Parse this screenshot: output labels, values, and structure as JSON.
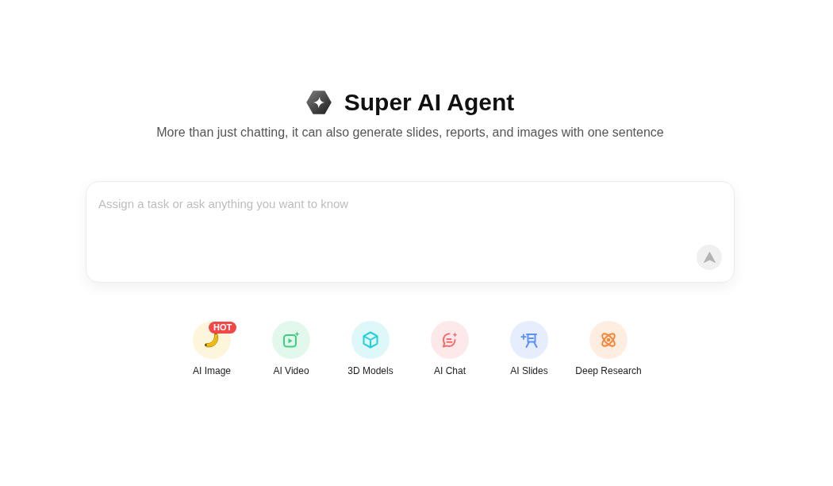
{
  "header": {
    "title": "Super AI Agent",
    "subtitle": "More than just chatting, it can also generate slides, reports, and images with one sentence"
  },
  "prompt": {
    "placeholder": "Assign a task or ask anything you want to know",
    "send_button": {
      "disabled": true
    }
  },
  "tools": [
    {
      "label": "AI Image",
      "badge": "HOT",
      "color": "#f5c518"
    },
    {
      "label": "AI Video",
      "color": "#3ccf7d"
    },
    {
      "label": "3D Models",
      "color": "#22cfdb"
    },
    {
      "label": "AI Chat",
      "color": "#f26b6b"
    },
    {
      "label": "AI Slides",
      "color": "#5b8ff9"
    },
    {
      "label": "Deep Research",
      "color": "#f5873a"
    }
  ]
}
